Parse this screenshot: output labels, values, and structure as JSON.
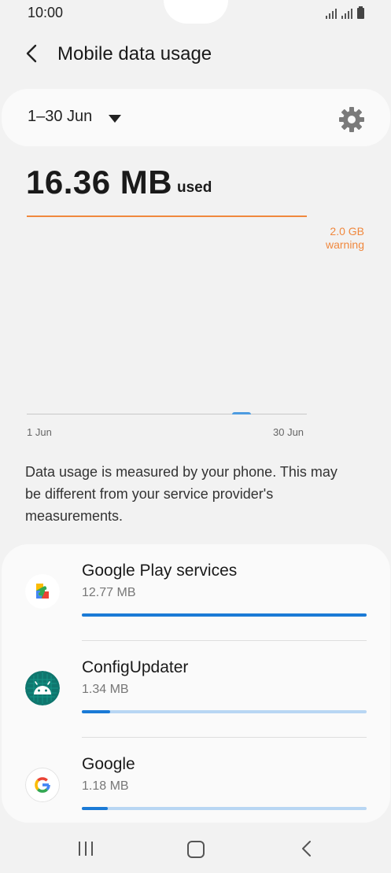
{
  "status_bar": {
    "time": "10:00"
  },
  "header": {
    "title": "Mobile data usage"
  },
  "period": {
    "label": "1–30 Jun"
  },
  "usage": {
    "amount": "16.36 MB",
    "suffix": "used"
  },
  "chart": {
    "warning_value": "2.0 GB",
    "warning_label": "warning",
    "x_start": "1 Jun",
    "x_end": "30 Jun",
    "warning_color": "#f0883e",
    "usage_color": "#4d9be0"
  },
  "disclaimer": "Data usage is measured by your phone. This may be different from your service provider's measurements.",
  "apps": [
    {
      "name": "Google Play services",
      "size": "12.77 MB",
      "usage_fraction": 1.0
    },
    {
      "name": "ConfigUpdater",
      "size": "1.34 MB",
      "usage_fraction": 0.1
    },
    {
      "name": "Google",
      "size": "1.18 MB",
      "usage_fraction": 0.09
    }
  ],
  "colors": {
    "bar_fill": "#1a7ad6",
    "bar_track": "#b8d6f3",
    "accent_warning": "#f0883e"
  }
}
